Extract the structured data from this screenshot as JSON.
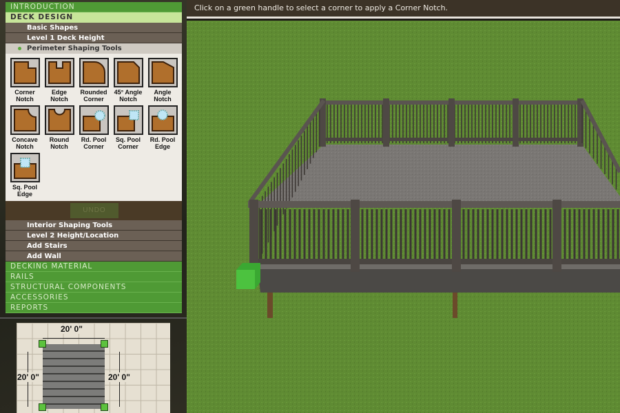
{
  "nav": {
    "introduction": "INTRODUCTION",
    "deck_design": "DECK DESIGN",
    "basic_shapes": "Basic Shapes",
    "level1": "Level 1 Deck Height",
    "perimeter": "Perimeter Shaping Tools",
    "interior": "Interior Shaping Tools",
    "level2": "Level 2 Height/Location",
    "add_stairs": "Add Stairs",
    "add_wall": "Add Wall",
    "decking_material": "DECKING MATERIAL",
    "rails": "RAILS",
    "structural": "STRUCTURAL COMPONENTS",
    "accessories": "ACCESSORIES",
    "reports": "REPORTS"
  },
  "tools": [
    {
      "l1": "Corner",
      "l2": "Notch",
      "shape": "corner"
    },
    {
      "l1": "Edge",
      "l2": "Notch",
      "shape": "edge"
    },
    {
      "l1": "Rounded",
      "l2": "Corner",
      "shape": "rounded"
    },
    {
      "l1": "45° Angle",
      "l2": "Notch",
      "shape": "angle45"
    },
    {
      "l1": "Angle",
      "l2": "Notch",
      "shape": "angle"
    },
    {
      "l1": "Concave",
      "l2": "Notch",
      "shape": "concave"
    },
    {
      "l1": "Round",
      "l2": "Notch",
      "shape": "round"
    },
    {
      "l1": "Rd. Pool",
      "l2": "Corner",
      "shape": "rdpoolcorner"
    },
    {
      "l1": "Sq. Pool",
      "l2": "Corner",
      "shape": "sqpoolcorner"
    },
    {
      "l1": "Rd. Pool",
      "l2": "Edge",
      "shape": "rdpooledge"
    },
    {
      "l1": "Sq. Pool",
      "l2": "Edge",
      "shape": "sqpooledge"
    }
  ],
  "undo": "UNDO",
  "minimap": {
    "top": "20' 0\"",
    "left": "20' 0\"",
    "right": "20' 0\""
  },
  "instruction": "Click on a green handle to select a corner to apply a Corner Notch.",
  "colors": {
    "grass": "#5e8a32",
    "deck_brown": "#b06f2c",
    "handle": "#5cc23d",
    "menu_green": "#4f9a35"
  }
}
